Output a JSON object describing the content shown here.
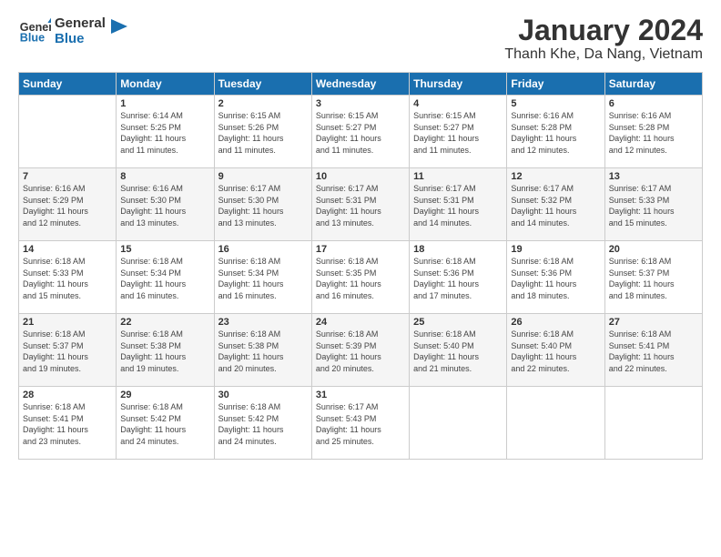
{
  "header": {
    "logo_line1": "General",
    "logo_line2": "Blue",
    "month": "January 2024",
    "location": "Thanh Khe, Da Nang, Vietnam"
  },
  "columns": [
    "Sunday",
    "Monday",
    "Tuesday",
    "Wednesday",
    "Thursday",
    "Friday",
    "Saturday"
  ],
  "weeks": [
    [
      {
        "day": "",
        "text": ""
      },
      {
        "day": "1",
        "text": "Sunrise: 6:14 AM\nSunset: 5:25 PM\nDaylight: 11 hours\nand 11 minutes."
      },
      {
        "day": "2",
        "text": "Sunrise: 6:15 AM\nSunset: 5:26 PM\nDaylight: 11 hours\nand 11 minutes."
      },
      {
        "day": "3",
        "text": "Sunrise: 6:15 AM\nSunset: 5:27 PM\nDaylight: 11 hours\nand 11 minutes."
      },
      {
        "day": "4",
        "text": "Sunrise: 6:15 AM\nSunset: 5:27 PM\nDaylight: 11 hours\nand 11 minutes."
      },
      {
        "day": "5",
        "text": "Sunrise: 6:16 AM\nSunset: 5:28 PM\nDaylight: 11 hours\nand 12 minutes."
      },
      {
        "day": "6",
        "text": "Sunrise: 6:16 AM\nSunset: 5:28 PM\nDaylight: 11 hours\nand 12 minutes."
      }
    ],
    [
      {
        "day": "7",
        "text": "Sunrise: 6:16 AM\nSunset: 5:29 PM\nDaylight: 11 hours\nand 12 minutes."
      },
      {
        "day": "8",
        "text": "Sunrise: 6:16 AM\nSunset: 5:30 PM\nDaylight: 11 hours\nand 13 minutes."
      },
      {
        "day": "9",
        "text": "Sunrise: 6:17 AM\nSunset: 5:30 PM\nDaylight: 11 hours\nand 13 minutes."
      },
      {
        "day": "10",
        "text": "Sunrise: 6:17 AM\nSunset: 5:31 PM\nDaylight: 11 hours\nand 13 minutes."
      },
      {
        "day": "11",
        "text": "Sunrise: 6:17 AM\nSunset: 5:31 PM\nDaylight: 11 hours\nand 14 minutes."
      },
      {
        "day": "12",
        "text": "Sunrise: 6:17 AM\nSunset: 5:32 PM\nDaylight: 11 hours\nand 14 minutes."
      },
      {
        "day": "13",
        "text": "Sunrise: 6:17 AM\nSunset: 5:33 PM\nDaylight: 11 hours\nand 15 minutes."
      }
    ],
    [
      {
        "day": "14",
        "text": "Sunrise: 6:18 AM\nSunset: 5:33 PM\nDaylight: 11 hours\nand 15 minutes."
      },
      {
        "day": "15",
        "text": "Sunrise: 6:18 AM\nSunset: 5:34 PM\nDaylight: 11 hours\nand 16 minutes."
      },
      {
        "day": "16",
        "text": "Sunrise: 6:18 AM\nSunset: 5:34 PM\nDaylight: 11 hours\nand 16 minutes."
      },
      {
        "day": "17",
        "text": "Sunrise: 6:18 AM\nSunset: 5:35 PM\nDaylight: 11 hours\nand 16 minutes."
      },
      {
        "day": "18",
        "text": "Sunrise: 6:18 AM\nSunset: 5:36 PM\nDaylight: 11 hours\nand 17 minutes."
      },
      {
        "day": "19",
        "text": "Sunrise: 6:18 AM\nSunset: 5:36 PM\nDaylight: 11 hours\nand 18 minutes."
      },
      {
        "day": "20",
        "text": "Sunrise: 6:18 AM\nSunset: 5:37 PM\nDaylight: 11 hours\nand 18 minutes."
      }
    ],
    [
      {
        "day": "21",
        "text": "Sunrise: 6:18 AM\nSunset: 5:37 PM\nDaylight: 11 hours\nand 19 minutes."
      },
      {
        "day": "22",
        "text": "Sunrise: 6:18 AM\nSunset: 5:38 PM\nDaylight: 11 hours\nand 19 minutes."
      },
      {
        "day": "23",
        "text": "Sunrise: 6:18 AM\nSunset: 5:38 PM\nDaylight: 11 hours\nand 20 minutes."
      },
      {
        "day": "24",
        "text": "Sunrise: 6:18 AM\nSunset: 5:39 PM\nDaylight: 11 hours\nand 20 minutes."
      },
      {
        "day": "25",
        "text": "Sunrise: 6:18 AM\nSunset: 5:40 PM\nDaylight: 11 hours\nand 21 minutes."
      },
      {
        "day": "26",
        "text": "Sunrise: 6:18 AM\nSunset: 5:40 PM\nDaylight: 11 hours\nand 22 minutes."
      },
      {
        "day": "27",
        "text": "Sunrise: 6:18 AM\nSunset: 5:41 PM\nDaylight: 11 hours\nand 22 minutes."
      }
    ],
    [
      {
        "day": "28",
        "text": "Sunrise: 6:18 AM\nSunset: 5:41 PM\nDaylight: 11 hours\nand 23 minutes."
      },
      {
        "day": "29",
        "text": "Sunrise: 6:18 AM\nSunset: 5:42 PM\nDaylight: 11 hours\nand 24 minutes."
      },
      {
        "day": "30",
        "text": "Sunrise: 6:18 AM\nSunset: 5:42 PM\nDaylight: 11 hours\nand 24 minutes."
      },
      {
        "day": "31",
        "text": "Sunrise: 6:17 AM\nSunset: 5:43 PM\nDaylight: 11 hours\nand 25 minutes."
      },
      {
        "day": "",
        "text": ""
      },
      {
        "day": "",
        "text": ""
      },
      {
        "day": "",
        "text": ""
      }
    ]
  ]
}
